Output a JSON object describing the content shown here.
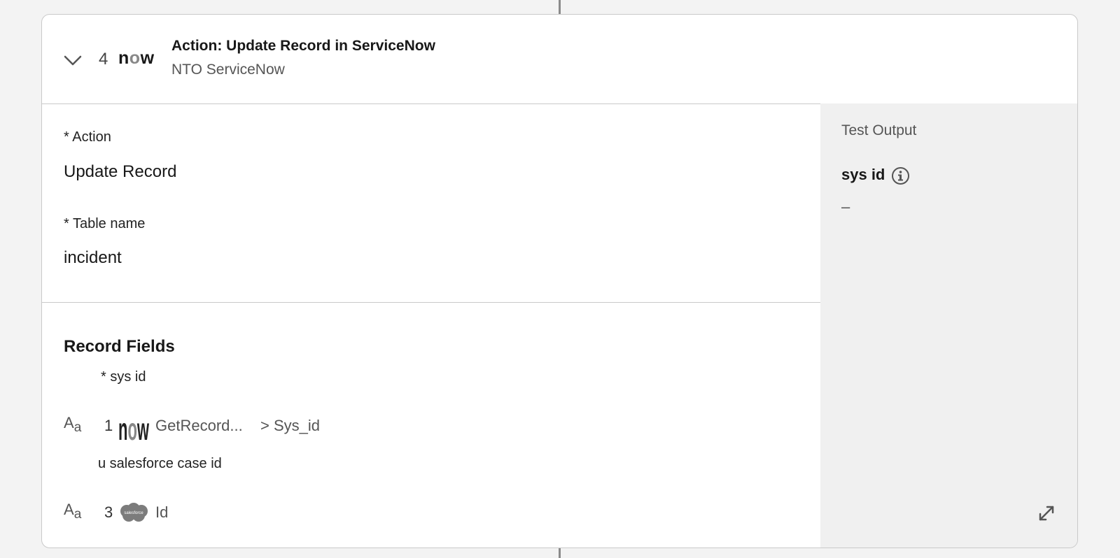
{
  "step": {
    "number": "4",
    "logo_text": "now",
    "title": "Action: Update Record in ServiceNow",
    "subtitle": "NTO ServiceNow"
  },
  "config": {
    "action_label": "* Action",
    "action_value": "Update Record",
    "table_label": "* Table name",
    "table_value": "incident"
  },
  "record_fields": {
    "title": "Record Fields",
    "fields": [
      {
        "label": "* sys id",
        "type_icon": "text-type-icon",
        "ref_step": "1",
        "ref_source_icon": "servicenow-logo",
        "ref_name": "GetRecord...",
        "ref_path": "> Sys_id"
      },
      {
        "label": "u salesforce case id",
        "type_icon": "text-type-icon",
        "ref_step": "3",
        "ref_source_icon": "salesforce-logo",
        "ref_name": "Id"
      }
    ],
    "salesforce_logo_text": "salesforce"
  },
  "test_output": {
    "title": "Test Output",
    "field_name": "sys id",
    "field_value": "–"
  },
  "colors": {
    "panel_bg": "#f0f0f0",
    "border": "#c9c9c9",
    "connector": "#8a8a8a",
    "sf_cloud": "#7c7c7c"
  }
}
